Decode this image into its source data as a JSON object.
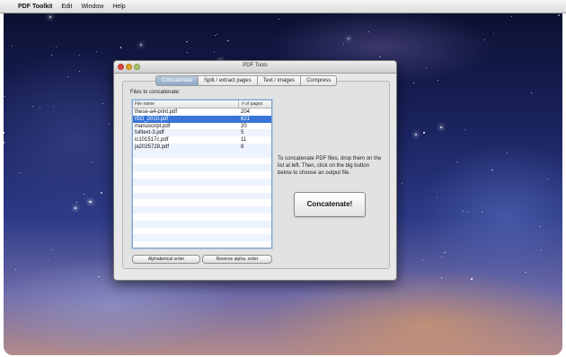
{
  "menubar": {
    "apple": "",
    "app": "PDF Toolkit",
    "items": [
      "Edit",
      "Window",
      "Help"
    ]
  },
  "window": {
    "title": "PDF Tools",
    "tabs": [
      "Concatenate",
      "Split / extract pages",
      "Text / images",
      "Compress"
    ],
    "active_tab": "Concatenate"
  },
  "concatenate": {
    "files_label": "Files to concatenate:",
    "columns": [
      "File name",
      "# of pages"
    ],
    "files": [
      {
        "name": "these-a4-print.pdf",
        "pages": "204"
      },
      {
        "name": "ISO_2010.pdf",
        "pages": "621",
        "selected": true
      },
      {
        "name": "manuscript.pdf",
        "pages": "20"
      },
      {
        "name": "fulltext-3.pdf",
        "pages": "5"
      },
      {
        "name": "ic101517c.pdf",
        "pages": "11"
      },
      {
        "name": "ja2025728.pdf",
        "pages": "8"
      }
    ],
    "alpha_button": "Alphabetical order",
    "reverse_button": "Reverse alpha. order",
    "instructions": "To concatenate PDF files, drop them on the list at left. Then, click on the big button below to choose an output file.",
    "concat_button": "Concatenate!"
  },
  "colors": {
    "selection": "#3875d7",
    "active_tab": "#8ea8c8",
    "close": "#e0443e",
    "minimize": "#dea123",
    "zoom": "#a9c66a"
  }
}
